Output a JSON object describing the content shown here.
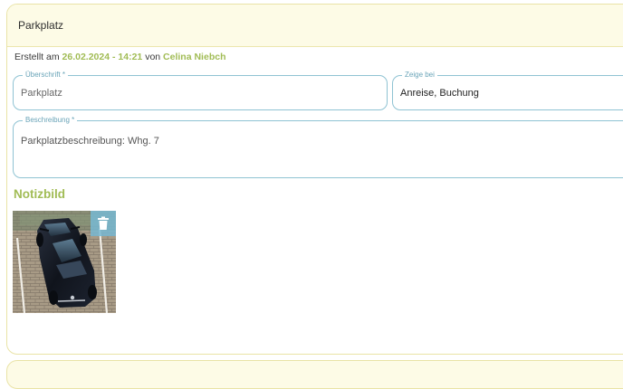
{
  "card": {
    "title": "Parkplatz"
  },
  "meta": {
    "prefix": "Erstellt am",
    "datetime": "26.02.2024 - 14:21",
    "by": "von",
    "author": "Celina Niebch"
  },
  "form": {
    "headline": {
      "label": "Überschrift *",
      "value": "Parkplatz"
    },
    "show_at": {
      "label": "Zeige bei",
      "value": "Anreise, Buchung"
    },
    "description": {
      "label": "Beschreibung *",
      "value": "Parkplatzbeschreibung: Whg. 7"
    }
  },
  "note_image": {
    "title": "Notizbild",
    "delete_icon": "trash-icon"
  },
  "colors": {
    "accent_green": "#a1bc55",
    "field_border": "#8fc3d3",
    "header_bg": "#fdfbe6",
    "card_border": "#e9e3a6"
  }
}
